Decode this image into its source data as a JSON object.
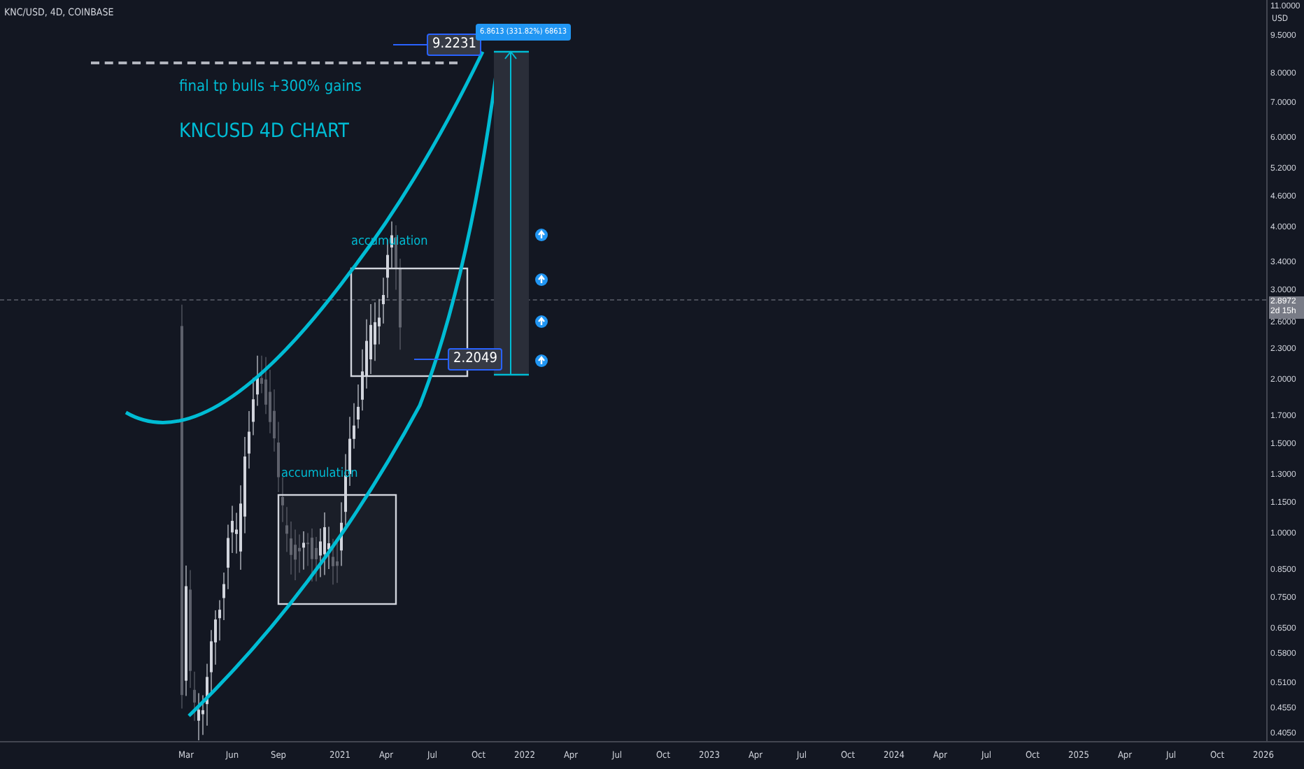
{
  "header": {
    "symbol": "KNC/USD, 4D, COINBASE"
  },
  "annotations": {
    "target_label": "final tp bulls +300% gains",
    "title": "KNCUSD 4D CHART",
    "target_price": "9.2231",
    "measure": "6.8613 (331.82%) 68613",
    "support_price": "2.2049",
    "zones": [
      {
        "label": "accumulation"
      },
      {
        "label": "accumulation"
      }
    ]
  },
  "price_axis": {
    "currency": "USD",
    "ticks": [
      "11.0000",
      "9.5000",
      "8.0000",
      "7.0000",
      "6.0000",
      "5.2000",
      "4.6000",
      "4.0000",
      "3.4000",
      "3.0000",
      "2.6000",
      "2.3000",
      "2.0000",
      "1.7000",
      "1.5000",
      "1.3000",
      "1.1500",
      "1.0000",
      "0.8500",
      "0.7500",
      "0.6500",
      "0.5800",
      "0.5100",
      "0.4550",
      "0.4050"
    ],
    "current_price": "2.8972",
    "countdown": "2d 15h"
  },
  "time_axis": {
    "ticks": [
      "Mar",
      "Jun",
      "Sep",
      "2021",
      "Apr",
      "Jul",
      "Oct",
      "2022",
      "Apr",
      "Jul",
      "Oct",
      "2023",
      "Apr",
      "Jul",
      "Oct",
      "2024",
      "Apr",
      "Jul",
      "Oct",
      "2025",
      "Apr",
      "Jul",
      "Oct",
      "2026"
    ]
  }
}
